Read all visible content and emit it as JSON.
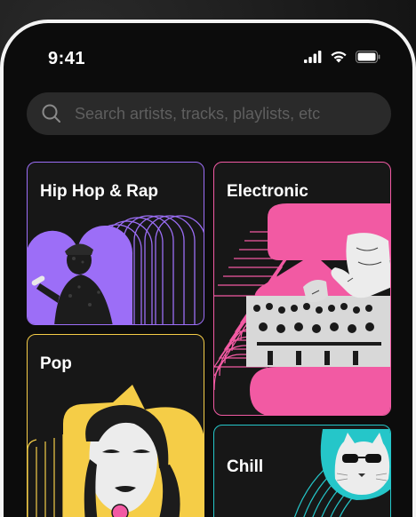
{
  "status_bar": {
    "time": "9:41"
  },
  "search": {
    "placeholder": "Search artists, tracks, playlists, etc"
  },
  "genres": [
    {
      "label": "Hip Hop & Rap",
      "accent": "#9c6ef7"
    },
    {
      "label": "Electronic",
      "accent": "#f25aa3"
    },
    {
      "label": "Pop",
      "accent": "#f5cd47"
    },
    {
      "label": "Chill",
      "accent": "#25c6c9"
    }
  ],
  "icons": [
    "search-icon",
    "cellular-signal-icon",
    "wifi-icon",
    "battery-icon"
  ]
}
